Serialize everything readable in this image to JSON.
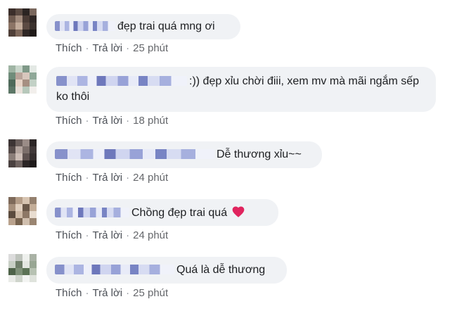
{
  "comments": [
    {
      "text": "đẹp trai quá mng ơi",
      "like_label": "Thích",
      "reply_label": "Trả lời",
      "time": "25 phút"
    },
    {
      "text": ":)) đẹp xỉu chời điii, xem mv mà mãi ngắm sếp ko thôi",
      "like_label": "Thích",
      "reply_label": "Trả lời",
      "time": "18 phút"
    },
    {
      "text": "Dễ thương xỉu~~",
      "like_label": "Thích",
      "reply_label": "Trả lời",
      "time": "24 phút"
    },
    {
      "text": "Chồng đẹp trai quá",
      "like_label": "Thích",
      "reply_label": "Trả lời",
      "time": "24 phút",
      "emoji": "heart-icon"
    },
    {
      "text": "Quá là dễ thương",
      "like_label": "Thích",
      "reply_label": "Trả lời",
      "time": "25 phút"
    }
  ],
  "colors": {
    "bubble_bg": "#f0f2f5",
    "action_text": "#65676b",
    "heart": "#e0245e"
  }
}
